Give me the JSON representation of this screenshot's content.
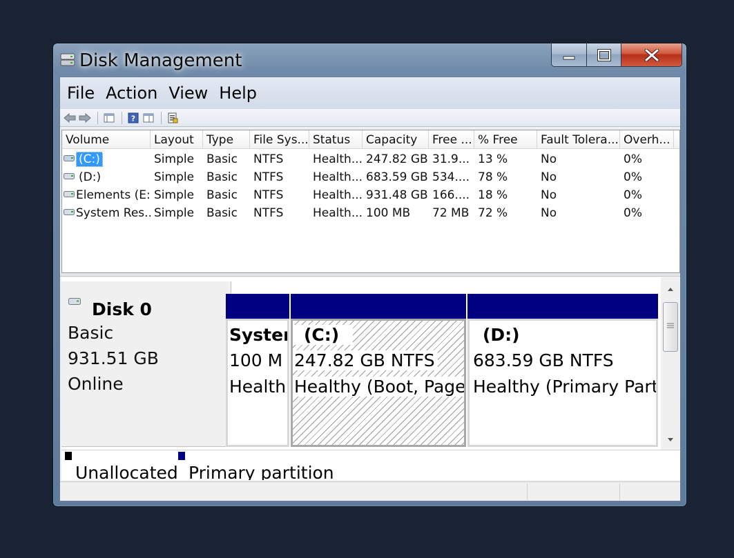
{
  "window": {
    "title": "Disk Management"
  },
  "menu": [
    "File",
    "Action",
    "View",
    "Help"
  ],
  "columns": [
    "Volume",
    "Layout",
    "Type",
    "File Sys...",
    "Status",
    "Capacity",
    "Free ...",
    "% Free",
    "Fault Tolera...",
    "Overh..."
  ],
  "volumes": [
    {
      "name": "(C:)",
      "layout": "Simple",
      "type": "Basic",
      "fs": "NTFS",
      "status": "Health...",
      "capacity": "247.82 GB",
      "free": "31.9...",
      "pct_free": "13 %",
      "fault": "No",
      "overhead": "0%"
    },
    {
      "name": "(D:)",
      "layout": "Simple",
      "type": "Basic",
      "fs": "NTFS",
      "status": "Health...",
      "capacity": "683.59 GB",
      "free": "534....",
      "pct_free": "78 %",
      "fault": "No",
      "overhead": "0%"
    },
    {
      "name": "Elements (E:)",
      "layout": "Simple",
      "type": "Basic",
      "fs": "NTFS",
      "status": "Health...",
      "capacity": "931.48 GB",
      "free": "166....",
      "pct_free": "18 %",
      "fault": "No",
      "overhead": "0%"
    },
    {
      "name": "System Res...",
      "layout": "Simple",
      "type": "Basic",
      "fs": "NTFS",
      "status": "Health...",
      "capacity": "100 MB",
      "free": "72 MB",
      "pct_free": "72 %",
      "fault": "No",
      "overhead": "0%"
    }
  ],
  "disk": {
    "name": "Disk 0",
    "type": "Basic",
    "size": "931.51 GB",
    "state": "Online"
  },
  "partitions": [
    {
      "label": "System",
      "size": "100 M",
      "status": "Health"
    },
    {
      "label": "(C:)",
      "size": "247.82 GB NTFS",
      "status": "Healthy (Boot, Page"
    },
    {
      "label": "(D:)",
      "size": "683.59 GB NTFS",
      "status": "Healthy (Primary Partit"
    }
  ],
  "legend": [
    {
      "label": "Unallocated",
      "color": "#000000"
    },
    {
      "label": "Primary partition",
      "color": "#000080"
    }
  ],
  "colors": {
    "primary_partition": "#000080",
    "selection": "#3399ff",
    "close_button": "#c8432a"
  },
  "icons": {
    "toolbar": [
      "back-arrow-icon",
      "forward-arrow-icon",
      "console-tree-icon",
      "help-icon",
      "properties-icon",
      "export-icon"
    ]
  }
}
